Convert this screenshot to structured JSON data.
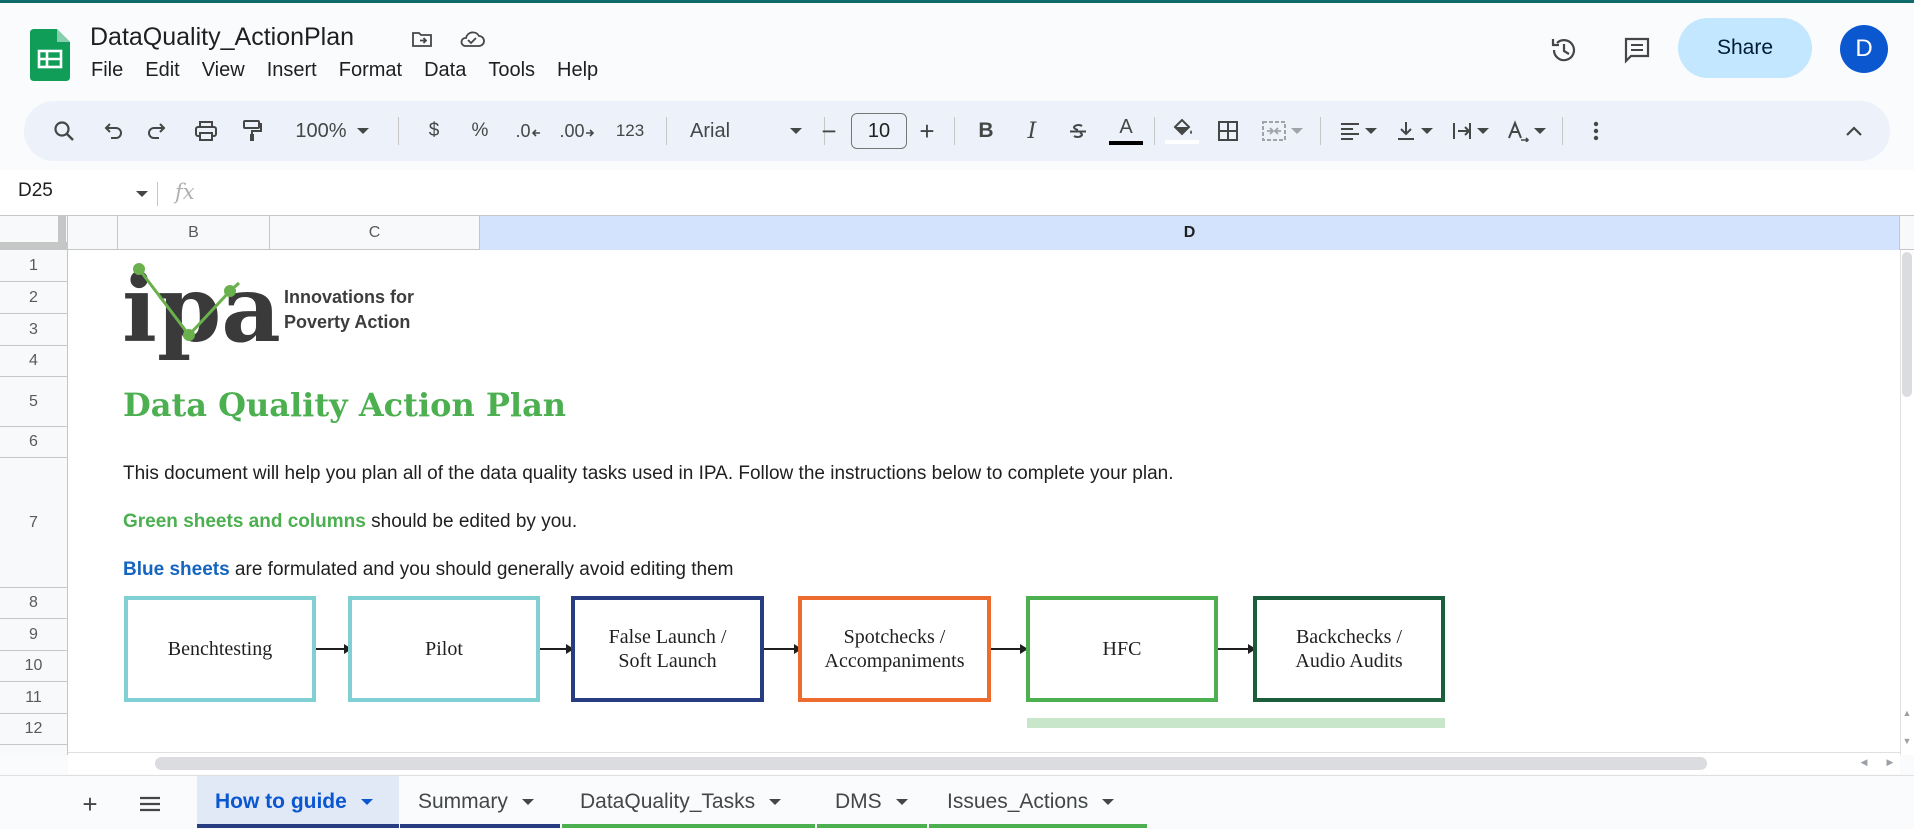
{
  "app": {
    "doc_title": "DataQuality_ActionPlan",
    "menu": [
      "File",
      "Edit",
      "View",
      "Insert",
      "Format",
      "Data",
      "Tools",
      "Help"
    ],
    "share_label": "Share",
    "avatar_initial": "D"
  },
  "toolbar": {
    "zoom": "100%",
    "currency": "$",
    "percent": "%",
    "decrease_decimal": ".0",
    "increase_decimal": ".00",
    "number_format": "123",
    "font": "Arial",
    "font_size": "10",
    "bold": "B",
    "italic": "I",
    "text_color": "A"
  },
  "formula_bar": {
    "cell_ref": "D25",
    "fx": "fx"
  },
  "grid": {
    "columns": [
      "B",
      "C",
      "D"
    ],
    "selected_column": "D",
    "rows": [
      "1",
      "2",
      "3",
      "4",
      "5",
      "6",
      "7",
      "8",
      "9",
      "10",
      "11",
      "12"
    ]
  },
  "content": {
    "logo_text": "ipa",
    "logo_tagline_1": "Innovations for",
    "logo_tagline_2": "Poverty Action",
    "title": "Data Quality Action Plan",
    "intro": "This document will help you plan all of the data quality tasks used in IPA. Follow the instructions below to complete your plan.",
    "green_label": "Green sheets and columns",
    "green_rest": " should be edited by you.",
    "blue_label": "Blue sheets",
    "blue_rest": " are formulated and you should generally avoid editing them",
    "flow": [
      {
        "label_1": "Benchtesting",
        "label_2": "",
        "color": "#80d0d3"
      },
      {
        "label_1": "Pilot",
        "label_2": "",
        "color": "#80d0d3"
      },
      {
        "label_1": "False Launch /",
        "label_2": "Soft Launch",
        "color": "#283c82"
      },
      {
        "label_1": "Spotchecks /",
        "label_2": "Accompaniments",
        "color": "#ec6b2d"
      },
      {
        "label_1": "HFC",
        "label_2": "",
        "color": "#4caf50"
      },
      {
        "label_1": "Backchecks /",
        "label_2": "Audio Audits",
        "color": "#1b5e3b"
      }
    ]
  },
  "sheet_tabs": [
    {
      "label": "How to guide",
      "active": true,
      "underline": "#283c82"
    },
    {
      "label": "Summary",
      "active": false,
      "underline": "#283c82"
    },
    {
      "label": "DataQuality_Tasks",
      "active": false,
      "underline": "#4caf50"
    },
    {
      "label": "DMS",
      "active": false,
      "underline": "#4caf50"
    },
    {
      "label": "Issues_Actions",
      "active": false,
      "underline": "#4caf50"
    }
  ],
  "colors": {
    "accent_green": "#4caf50",
    "accent_blue": "#1565c0",
    "selection": "#d3e3fd",
    "share_bg": "#c2e7ff"
  }
}
